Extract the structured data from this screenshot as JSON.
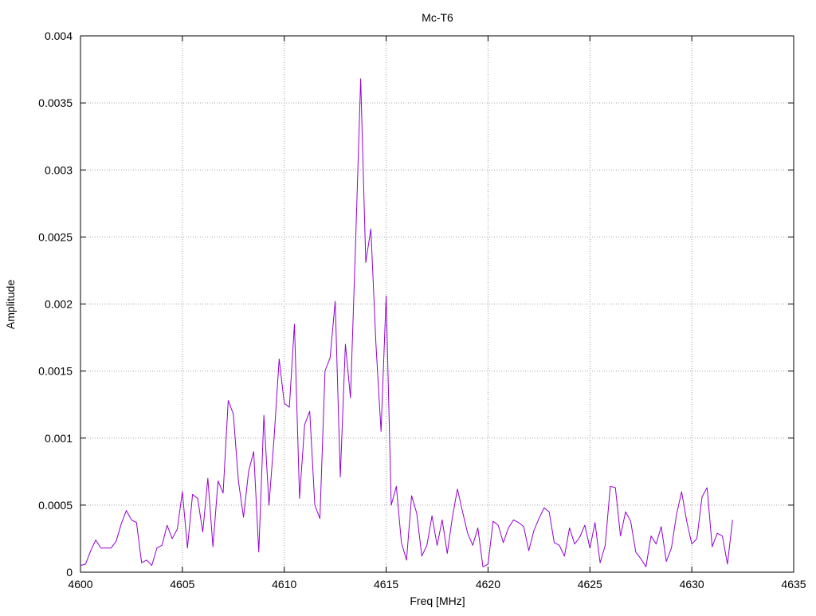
{
  "chart_data": {
    "type": "line",
    "title": "Mc-T6",
    "xlabel": "Freq [MHz]",
    "ylabel": "Amplitude",
    "xlim": [
      4600,
      4635
    ],
    "ylim": [
      0,
      0.004
    ],
    "x_ticks": [
      "4600",
      "4605",
      "4610",
      "4615",
      "4620",
      "4625",
      "4630",
      "4635"
    ],
    "y_ticks": [
      "0",
      "0.0005",
      "0.001",
      "0.0015",
      "0.002",
      "0.0025",
      "0.003",
      "0.0035",
      "0.004"
    ],
    "grid": true,
    "line_color": "#9400d3",
    "series": [
      {
        "x": [
          4600.0,
          4600.25,
          4600.5,
          4600.75,
          4601.0,
          4601.25,
          4601.5,
          4601.75,
          4602.0,
          4602.25,
          4602.5,
          4602.75,
          4603.0,
          4603.25,
          4603.5,
          4603.75,
          4604.0,
          4604.25,
          4604.5,
          4604.75,
          4605.0,
          4605.25,
          4605.5,
          4605.75,
          4606.0,
          4606.25,
          4606.5,
          4606.75,
          4607.0,
          4607.25,
          4607.5,
          4607.75,
          4608.0,
          4608.25,
          4608.5,
          4608.75,
          4609.0,
          4609.25,
          4609.5,
          4609.75,
          4610.0,
          4610.25,
          4610.5,
          4610.75,
          4611.0,
          4611.25,
          4611.5,
          4611.75,
          4612.0,
          4612.25,
          4612.5,
          4612.75,
          4613.0,
          4613.25,
          4613.5,
          4613.75,
          4614.0,
          4614.25,
          4614.5,
          4614.75,
          4615.0,
          4615.25,
          4615.5,
          4615.75,
          4616.0,
          4616.25,
          4616.5,
          4616.75,
          4617.0,
          4617.25,
          4617.5,
          4617.75,
          4618.0,
          4618.25,
          4618.5,
          4618.75,
          4619.0,
          4619.25,
          4619.5,
          4619.75,
          4620.0,
          4620.25,
          4620.5,
          4620.75,
          4621.0,
          4621.25,
          4621.5,
          4621.75,
          4622.0,
          4622.25,
          4622.5,
          4622.75,
          4623.0,
          4623.25,
          4623.5,
          4623.75,
          4624.0,
          4624.25,
          4624.5,
          4624.75,
          4625.0,
          4625.25,
          4625.5,
          4625.75,
          4626.0,
          4626.25,
          4626.5,
          4626.75,
          4627.0,
          4627.25,
          4627.5,
          4627.75,
          4628.0,
          4628.25,
          4628.5,
          4628.75,
          4629.0,
          4629.25,
          4629.5,
          4629.75,
          4630.0,
          4630.25,
          4630.5,
          4630.75,
          4631.0,
          4631.25,
          4631.5,
          4631.75,
          4632.0
        ],
        "values": [
          5e-05,
          6e-05,
          0.00016,
          0.00024,
          0.00018,
          0.00018,
          0.00018,
          0.00023,
          0.00036,
          0.00046,
          0.00039,
          0.00037,
          7e-05,
          9e-05,
          5e-05,
          0.00018,
          0.0002,
          0.00035,
          0.00025,
          0.00032,
          0.0006,
          0.00018,
          0.00058,
          0.00055,
          0.0003,
          0.0007,
          0.00019,
          0.00068,
          0.00059,
          0.00128,
          0.00118,
          0.00068,
          0.00041,
          0.00075,
          0.0009,
          0.00015,
          0.00117,
          0.0005,
          0.001,
          0.00159,
          0.00126,
          0.00123,
          0.00185,
          0.00055,
          0.0011,
          0.0012,
          0.0005,
          0.0004,
          0.0015,
          0.0016,
          0.00202,
          0.00071,
          0.0017,
          0.0013,
          0.00245,
          0.00368,
          0.00231,
          0.00256,
          0.0017,
          0.00105,
          0.00206,
          0.0005,
          0.00064,
          0.00022,
          9e-05,
          0.00057,
          0.00044,
          0.00012,
          0.0002,
          0.00042,
          0.0002,
          0.00039,
          0.00014,
          0.00041,
          0.00062,
          0.00045,
          0.00029,
          0.0002,
          0.00033,
          4e-05,
          6e-05,
          0.00038,
          0.00035,
          0.00022,
          0.00033,
          0.00039,
          0.00037,
          0.00034,
          0.00016,
          0.00031,
          0.0004,
          0.00048,
          0.00045,
          0.00022,
          0.0002,
          0.00012,
          0.00033,
          0.00021,
          0.00026,
          0.00035,
          0.00018,
          0.00037,
          7e-05,
          0.0002,
          0.00064,
          0.00063,
          0.00027,
          0.00045,
          0.00038,
          0.00015,
          0.0001,
          4e-05,
          0.00027,
          0.00021,
          0.00034,
          8e-05,
          0.00018,
          0.00043,
          0.0006,
          0.00038,
          0.00021,
          0.00025,
          0.00056,
          0.00063,
          0.00019,
          0.00029,
          0.00027,
          6e-05,
          0.00039
        ]
      }
    ]
  }
}
